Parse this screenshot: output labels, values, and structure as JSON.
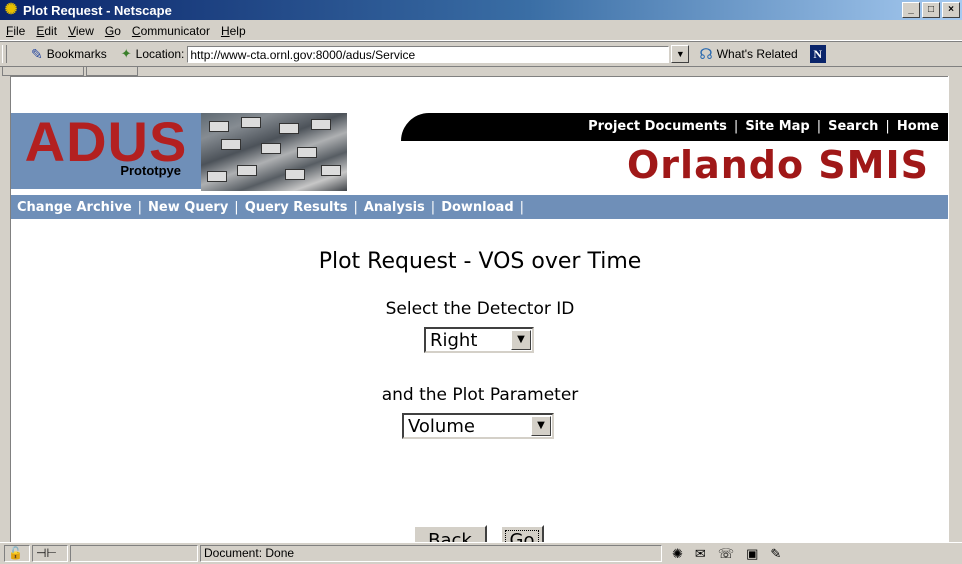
{
  "window": {
    "title": "Plot Request - Netscape",
    "controls": [
      "_",
      "□",
      "×"
    ]
  },
  "menu": [
    "File",
    "Edit",
    "View",
    "Go",
    "Communicator",
    "Help"
  ],
  "toolbar": {
    "bookmarks_label": "Bookmarks",
    "location_label": "Location:",
    "location_url": "http://www-cta.ornl.gov:8000/adus/Service",
    "whats_related_label": "What's Related",
    "n_logo": "N"
  },
  "site": {
    "logo_title": "ADUS",
    "logo_subtitle": "Prototpye",
    "brand": "Orlando SMIS",
    "top_links": [
      "Project Documents",
      "Site Map",
      "Search",
      "Home"
    ],
    "nav_links": [
      "Change Archive",
      "New Query",
      "Query Results",
      "Analysis",
      "Download"
    ]
  },
  "form": {
    "heading": "Plot Request - VOS over Time",
    "detector_label": "Select the Detector ID",
    "detector_value": "Right",
    "param_label": "and the Plot Parameter",
    "param_value": "Volume",
    "back_label": "Back",
    "go_label": "Go"
  },
  "status": {
    "text": "Document: Done"
  }
}
